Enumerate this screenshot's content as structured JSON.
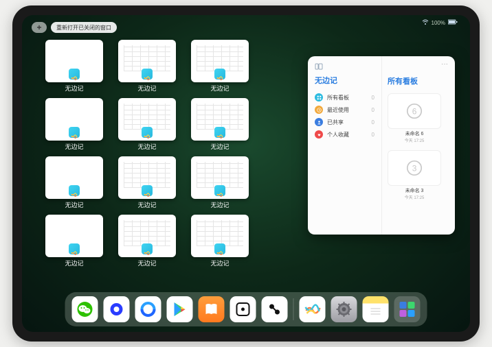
{
  "status": {
    "wifi": "wifi-icon",
    "battery": "100%"
  },
  "top": {
    "plus": "+",
    "reopen_label": "重新打开已关闭的窗口"
  },
  "windows": [
    {
      "label": "无边记",
      "variant": "blank"
    },
    {
      "label": "无边记",
      "variant": "table"
    },
    {
      "label": "无边记",
      "variant": "table"
    },
    {
      "label": "无边记",
      "variant": "blank"
    },
    {
      "label": "无边记",
      "variant": "table"
    },
    {
      "label": "无边记",
      "variant": "table"
    },
    {
      "label": "无边记",
      "variant": "blank"
    },
    {
      "label": "无边记",
      "variant": "table"
    },
    {
      "label": "无边记",
      "variant": "table"
    },
    {
      "label": "无边记",
      "variant": "blank"
    },
    {
      "label": "无边记",
      "variant": "table"
    },
    {
      "label": "无边记",
      "variant": "table"
    }
  ],
  "sidebar": {
    "app_title": "无边记",
    "right_title": "所有看板",
    "items": [
      {
        "label": "所有看板",
        "count": "0",
        "color": "#2bbbe0",
        "icon": "grid"
      },
      {
        "label": "最近使用",
        "count": "0",
        "color": "#f2a93c",
        "icon": "clock"
      },
      {
        "label": "已共享",
        "count": "0",
        "color": "#3a7de0",
        "icon": "person"
      },
      {
        "label": "个人收藏",
        "count": "0",
        "color": "#ef4a4a",
        "icon": "heart"
      }
    ],
    "boards": [
      {
        "label": "未命名 6",
        "meta": "今天 17:25",
        "digit": "6"
      },
      {
        "label": "未命名 3",
        "meta": "今天 17:25",
        "digit": "3"
      }
    ]
  },
  "dock": [
    {
      "name": "wechat",
      "bg": "#ffffff"
    },
    {
      "name": "quark",
      "bg": "#ffffff"
    },
    {
      "name": "qqbrowser",
      "bg": "#ffffff"
    },
    {
      "name": "play",
      "bg": "#ffffff"
    },
    {
      "name": "books",
      "bg": "linear-gradient(180deg,#ff9d3c,#ff7a1f)"
    },
    {
      "name": "dice",
      "bg": "#ffffff"
    },
    {
      "name": "camera-connect",
      "bg": "#ffffff"
    },
    {
      "name": "freeform",
      "bg": "#ffffff"
    },
    {
      "name": "settings",
      "bg": "linear-gradient(180deg,#d8d8dc,#9e9ea4)"
    },
    {
      "name": "notes",
      "bg": "linear-gradient(180deg,#ffe26a 0%,#ffe26a 28%,#fff 28%)"
    },
    {
      "name": "app-library",
      "bg": "rgba(255,255,255,.18)"
    }
  ]
}
